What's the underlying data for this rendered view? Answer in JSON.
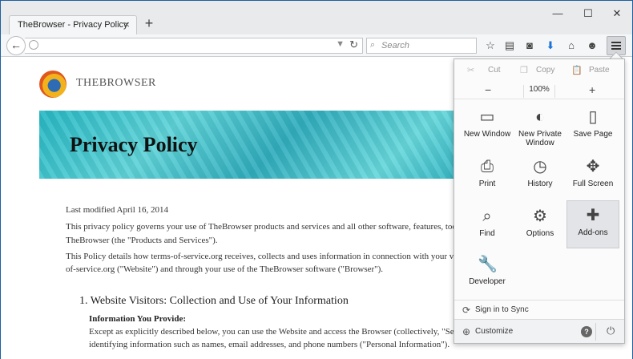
{
  "browser": {
    "tab_title": "TheBrowser - Privacy Policy",
    "search_placeholder": "Search"
  },
  "page": {
    "brand": "THEBROWSER",
    "heading": "Privacy Policy",
    "last_modified": "Last modified April 16, 2014",
    "para1_line1": "This privacy policy governs your use of TheBrowser products and services and all other software, features, tools, add-ons",
    "para1_line2": "TheBrowser (the \"Products and Services\").",
    "para2_line1": "This Policy details how terms-of-service.org receives, collects and uses information in connection with your visit to its w",
    "para2_line2": "of-service.org (\"Website\") and through your use of the TheBrowser software (\"Browser\").",
    "section1": "1. Website Visitors: Collection and Use of Your Information",
    "subhead": "Information You Provide:",
    "para3_line1": "Except as explicitly described below, you can use the Website and access the Browser (collectively, \"Service\") with",
    "para3_line2": "identifying information such as names, email addresses, and phone numbers (\"Personal Information\")."
  },
  "menu": {
    "cut": "Cut",
    "copy": "Copy",
    "paste": "Paste",
    "zoom_minus": "−",
    "zoom_level": "100%",
    "zoom_plus": "+",
    "items": [
      {
        "label": "New Window",
        "icon": "new-window-icon"
      },
      {
        "label": "New Private Window",
        "icon": "private-mask-icon"
      },
      {
        "label": "Save Page",
        "icon": "save-page-icon"
      },
      {
        "label": "Print",
        "icon": "print-icon"
      },
      {
        "label": "History",
        "icon": "history-clock-icon"
      },
      {
        "label": "Full Screen",
        "icon": "fullscreen-icon"
      },
      {
        "label": "Find",
        "icon": "find-magnifier-icon"
      },
      {
        "label": "Options",
        "icon": "options-gear-icon"
      },
      {
        "label": "Add-ons",
        "icon": "addons-puzzle-icon"
      },
      {
        "label": "Developer",
        "icon": "developer-wrench-icon"
      }
    ],
    "sign_in": "Sign in to Sync",
    "customize": "Customize"
  }
}
